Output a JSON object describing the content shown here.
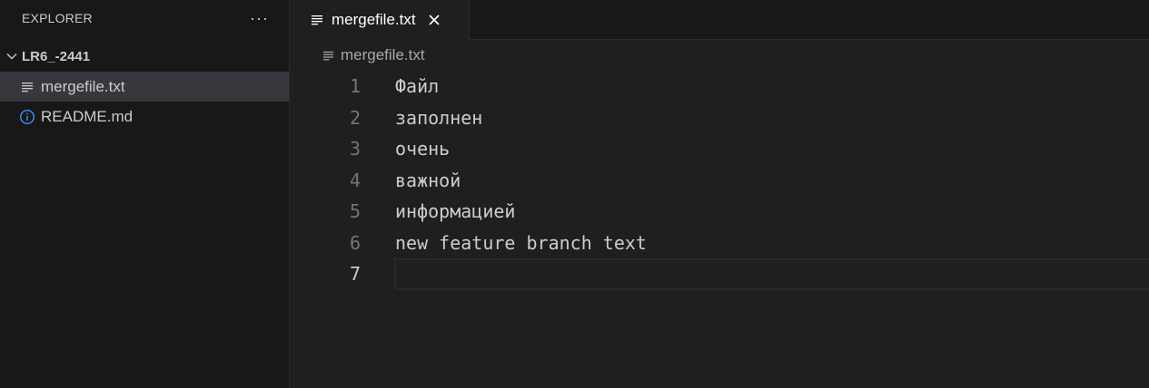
{
  "sidebar": {
    "title": "EXPLORER",
    "more_actions": "···",
    "folder": {
      "label": "LR6_-2441",
      "expanded": true
    },
    "files": [
      {
        "label": "mergefile.txt",
        "icon": "text-lines-icon",
        "selected": true
      },
      {
        "label": "README.md",
        "icon": "info-icon",
        "selected": false
      }
    ]
  },
  "tabs": [
    {
      "label": "mergefile.txt",
      "icon": "text-lines-icon",
      "active": true
    }
  ],
  "breadcrumb": {
    "label": "mergefile.txt",
    "icon": "text-lines-icon"
  },
  "editor": {
    "current_line": 7,
    "lines": [
      {
        "num": "1",
        "text": "Файл"
      },
      {
        "num": "2",
        "text": "заполнен"
      },
      {
        "num": "3",
        "text": "очень"
      },
      {
        "num": "4",
        "text": "важной"
      },
      {
        "num": "5",
        "text": "информацией"
      },
      {
        "num": "6",
        "text": "new feature branch text"
      },
      {
        "num": "7",
        "text": ""
      }
    ]
  },
  "colors": {
    "background": "#1f1f1f",
    "sidebar": "#181818",
    "selection": "#37373d",
    "info_icon": "#3794ff"
  }
}
